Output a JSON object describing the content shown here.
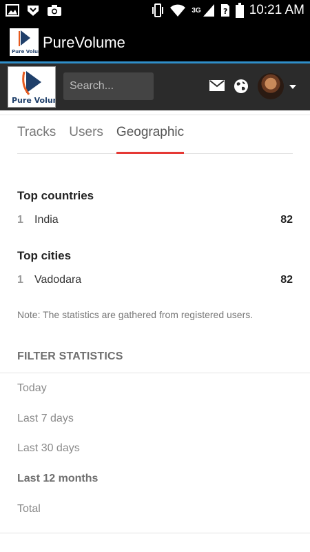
{
  "status_bar": {
    "time": "10:21 AM",
    "network": "3G"
  },
  "app_bar": {
    "title": "PureVolume",
    "logo_text": "Pure Volume"
  },
  "header": {
    "logo_text": "Pure Volume",
    "search_placeholder": "Search..."
  },
  "tabs": [
    {
      "label": "Tracks",
      "active": false
    },
    {
      "label": "Users",
      "active": false
    },
    {
      "label": "Geographic",
      "active": true
    }
  ],
  "top_countries": {
    "title": "Top countries",
    "rows": [
      {
        "rank": "1",
        "name": "India",
        "count": "82"
      }
    ]
  },
  "top_cities": {
    "title": "Top cities",
    "rows": [
      {
        "rank": "1",
        "name": "Vadodara",
        "count": "82"
      }
    ]
  },
  "note": "Note: The statistics are gathered from registered users.",
  "filter": {
    "title": "FILTER STATISTICS",
    "items": [
      {
        "label": "Today",
        "active": false
      },
      {
        "label": "Last 7 days",
        "active": false
      },
      {
        "label": "Last 30 days",
        "active": false
      },
      {
        "label": "Last 12 months",
        "active": true
      },
      {
        "label": "Total",
        "active": false
      }
    ]
  },
  "colors": {
    "accent": "#e53935",
    "appbar_accent": "#2f8ec9",
    "header_bg": "#2b2b2b"
  }
}
